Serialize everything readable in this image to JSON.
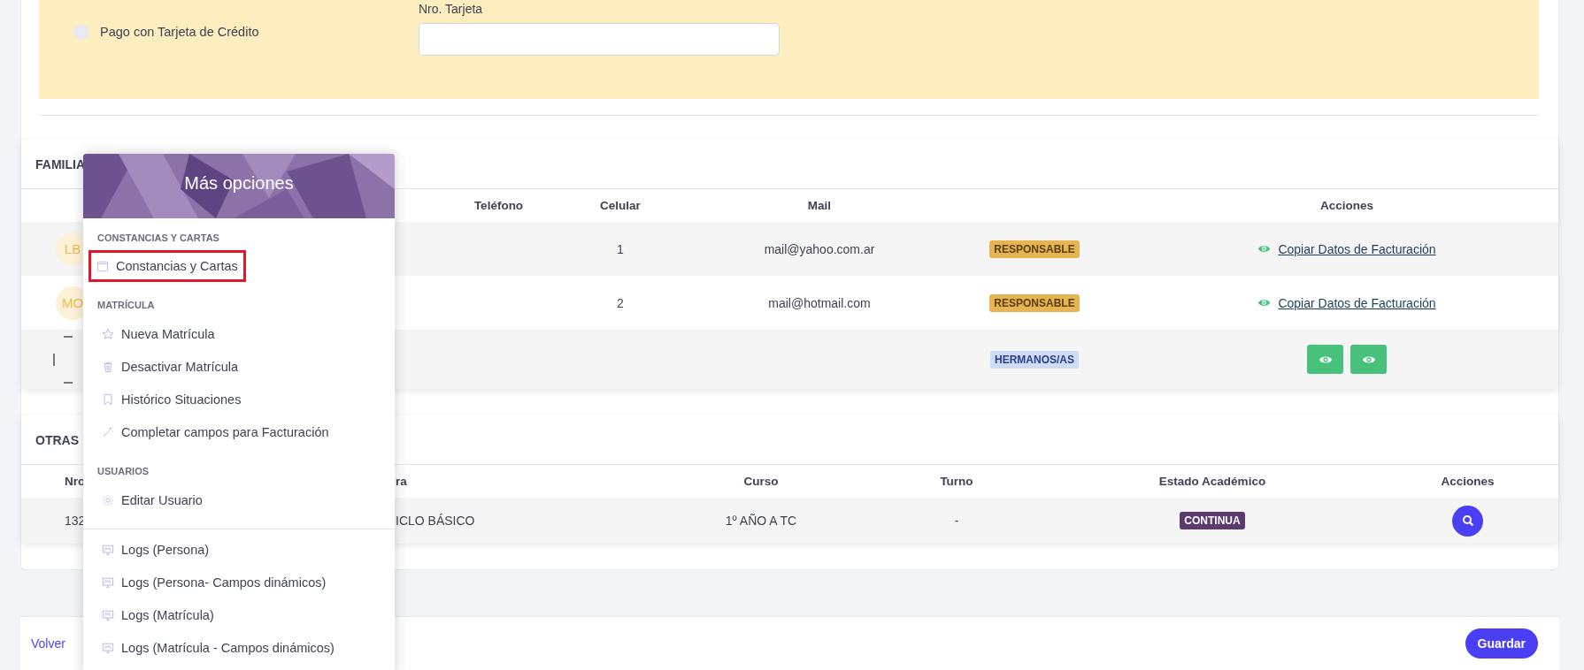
{
  "payment": {
    "radio_label": "Pago con Tarjeta de Crédito",
    "checked": false,
    "card_field": {
      "label": "Nro. Tarjeta"
    }
  },
  "family": {
    "title": "FAMILIA",
    "columns": [
      "Teléfono",
      "Celular",
      "Mail",
      "Acciones"
    ],
    "rows": [
      {
        "avatar": "LB",
        "celular": "1",
        "mail": "mail@yahoo.com.ar",
        "badge": {
          "text": "RESPONSABLE",
          "color": "#e6b450"
        },
        "actions": {
          "kind": "link",
          "text": "Copiar Datos de Facturación"
        }
      },
      {
        "avatar": "MO",
        "celular": "2",
        "mail": "mail@hotmail.com",
        "badge": {
          "text": "RESPONSABLE",
          "color": "#e6b450"
        },
        "actions": {
          "kind": "link",
          "text": "Copiar Datos de Facturación"
        }
      },
      {
        "badge": {
          "text": "HERMANOS/AS",
          "color": "#cfdcf7"
        },
        "actions": {
          "kind": "buttons",
          "buttons": [
            {
              "kind": "view"
            },
            {
              "kind": "view"
            }
          ]
        }
      }
    ]
  },
  "other": {
    "title": "OTRAS",
    "columns": [
      "Nro",
      "ra",
      "Curso",
      "Turno",
      "Estado Académico",
      "Acciones"
    ],
    "rows": [
      {
        "nro": "132",
        "column_2": "ICLO BÁSICO",
        "curso": "1º AÑO A TC",
        "turno": "-",
        "estado": {
          "text": "CONTINUA",
          "color": "#5b3a6e"
        }
      }
    ]
  },
  "footer": {
    "back": "Volver",
    "save": "Guardar"
  },
  "menu": {
    "title": "Más opciones",
    "sections": [
      {
        "label": "CONSTANCIAS Y CARTAS",
        "items": [
          {
            "label": "Constancias y Cartas",
            "selected": true
          }
        ]
      },
      {
        "label": "MATRÍCULA",
        "items": [
          {
            "label": "Nueva Matrícula",
            "selected": false
          },
          {
            "label": "Desactivar Matrícula",
            "selected": false
          },
          {
            "label": "Histórico Situaciones",
            "selected": false
          },
          {
            "label": "Completar campos para Facturación",
            "selected": false
          }
        ]
      },
      {
        "label": "USUARIOS",
        "items": [
          {
            "label": "Editar Usuario",
            "selected": false
          }
        ]
      },
      {
        "items": [
          {
            "label": "Logs (Persona)",
            "selected": false
          },
          {
            "label": "Logs (Persona- Campos dinámicos)",
            "selected": false
          },
          {
            "label": "Logs (Matrícula)",
            "selected": false
          },
          {
            "label": "Logs (Matrícula - Campos dinámicos)",
            "selected": false
          }
        ]
      }
    ]
  }
}
